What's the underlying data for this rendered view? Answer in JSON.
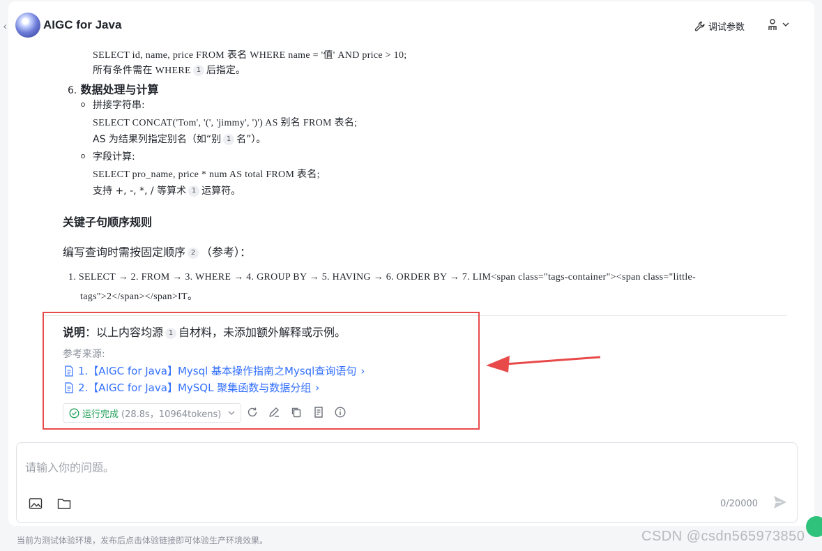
{
  "header": {
    "title": "AIGC for Java",
    "debug_label": "调试参数"
  },
  "content": {
    "partial_top_line": "SELECT id, name, price FROM 表名 WHERE name = '值' AND price > 10;",
    "where_note_a": "所有条件需在 WHERE",
    "where_note_cite": "1",
    "where_note_b": "后指定。",
    "section6": {
      "number": "6.",
      "title": "数据处理与计算",
      "items": [
        {
          "label": "拼接字符串:",
          "code": "SELECT CONCAT('Tom', '(', 'jimmy', ')') AS 别名 FROM 表名;",
          "note_a": "AS 为结果列指定别名（如“别",
          "cite": "1",
          "note_b": "名”）。"
        },
        {
          "label": "字段计算:",
          "code": "SELECT pro_name, price * num AS total FROM 表名;",
          "note_a": "支持 +, -, *, / 等算术",
          "cite": "1",
          "note_b": "运算符。"
        }
      ]
    },
    "rules_heading": "关键子句顺序规则",
    "rules_intro_a": "编写查询时需按固定顺序",
    "rules_intro_cite": "2",
    "rules_intro_b": "（参考）：",
    "order_line1": "1. SELECT → 2. FROM → 3. WHERE → 4. GROUP BY → 5. HAVING → 6. ORDER BY → 7. LIM<span class=\"tags-container\"><span class=\"little-",
    "order_line2": "tags\">2</span></span>IT。",
    "note_label": "说明",
    "note_a": "：以上内容均源",
    "note_cite": "1",
    "note_b": "自材料，未添加额外解释或示例。"
  },
  "references": {
    "title": "参考来源:",
    "items": [
      "1.【AIGC for Java】Mysql 基本操作指南之Mysql查询语句",
      "2.【AIGC for Java】MySQL 聚集函数与数据分组"
    ]
  },
  "status": {
    "label": "运行完成",
    "meta": "(28.8s，10964tokens)"
  },
  "input": {
    "placeholder": "请输入你的问题。",
    "counter": "0/20000"
  },
  "footer": {
    "note": "当前为测试体验环境，发布后点击体验链接即可体验生产环境效果。",
    "watermark": "CSDN @csdn565973850"
  },
  "colors": {
    "accent": "#3370ff",
    "success": "#1f9f57",
    "highlight": "#e84a4a"
  }
}
